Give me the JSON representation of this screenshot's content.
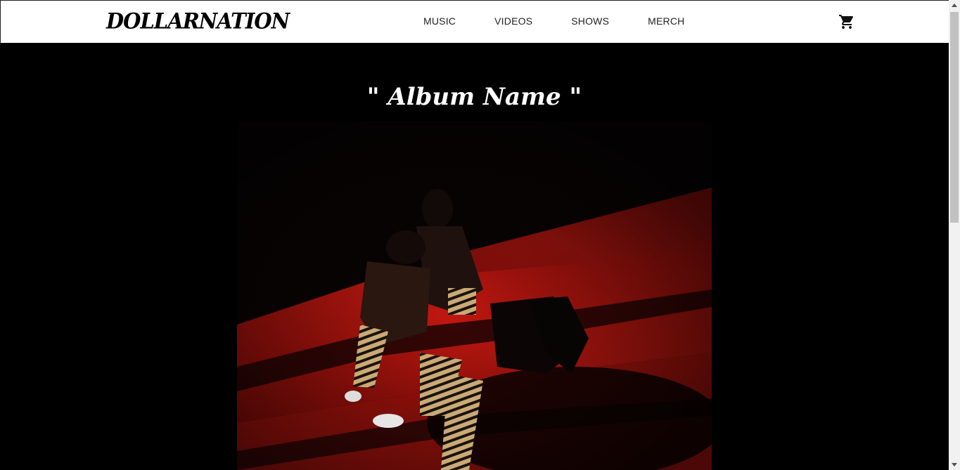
{
  "header": {
    "logo": "DOLLARNATION",
    "nav": [
      {
        "label": "MUSIC"
      },
      {
        "label": "VIDEOS"
      },
      {
        "label": "SHOWS"
      },
      {
        "label": "MERCH"
      }
    ],
    "cart_icon": "shopping-cart-icon"
  },
  "main": {
    "album_title": "\" Album Name \"",
    "cover_image": "album-cover-art"
  },
  "colors": {
    "nav_bg": "#ffffff",
    "page_bg": "#000000",
    "cover_red": "#b3110c"
  }
}
